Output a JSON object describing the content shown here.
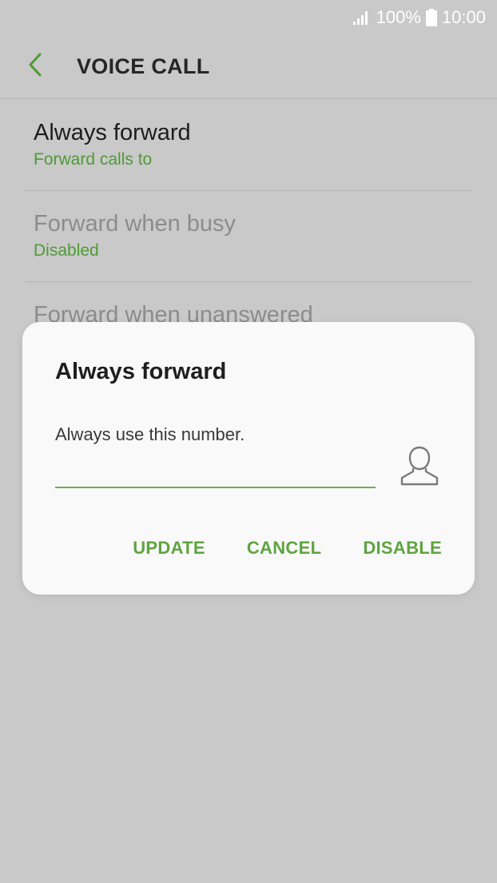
{
  "status_bar": {
    "battery": "100%",
    "time": "10:00"
  },
  "header": {
    "title": "VOICE CALL"
  },
  "settings": [
    {
      "title": "Always forward",
      "subtitle": "Forward calls to"
    },
    {
      "title": "Forward when busy",
      "subtitle": "Disabled"
    },
    {
      "title": "Forward when unanswered"
    }
  ],
  "dialog": {
    "title": "Always forward",
    "message": "Always use this number.",
    "input_value": "",
    "buttons": {
      "update": "UPDATE",
      "cancel": "CANCEL",
      "disable": "DISABLE"
    }
  },
  "colors": {
    "accent": "#5ea43f",
    "background": "#c9c9c9",
    "dialog": "#f9f9f9"
  },
  "icons": {
    "back": "chevron-left-icon",
    "signal": "signal-icon",
    "battery": "battery-icon",
    "contact": "person-outline-icon"
  }
}
